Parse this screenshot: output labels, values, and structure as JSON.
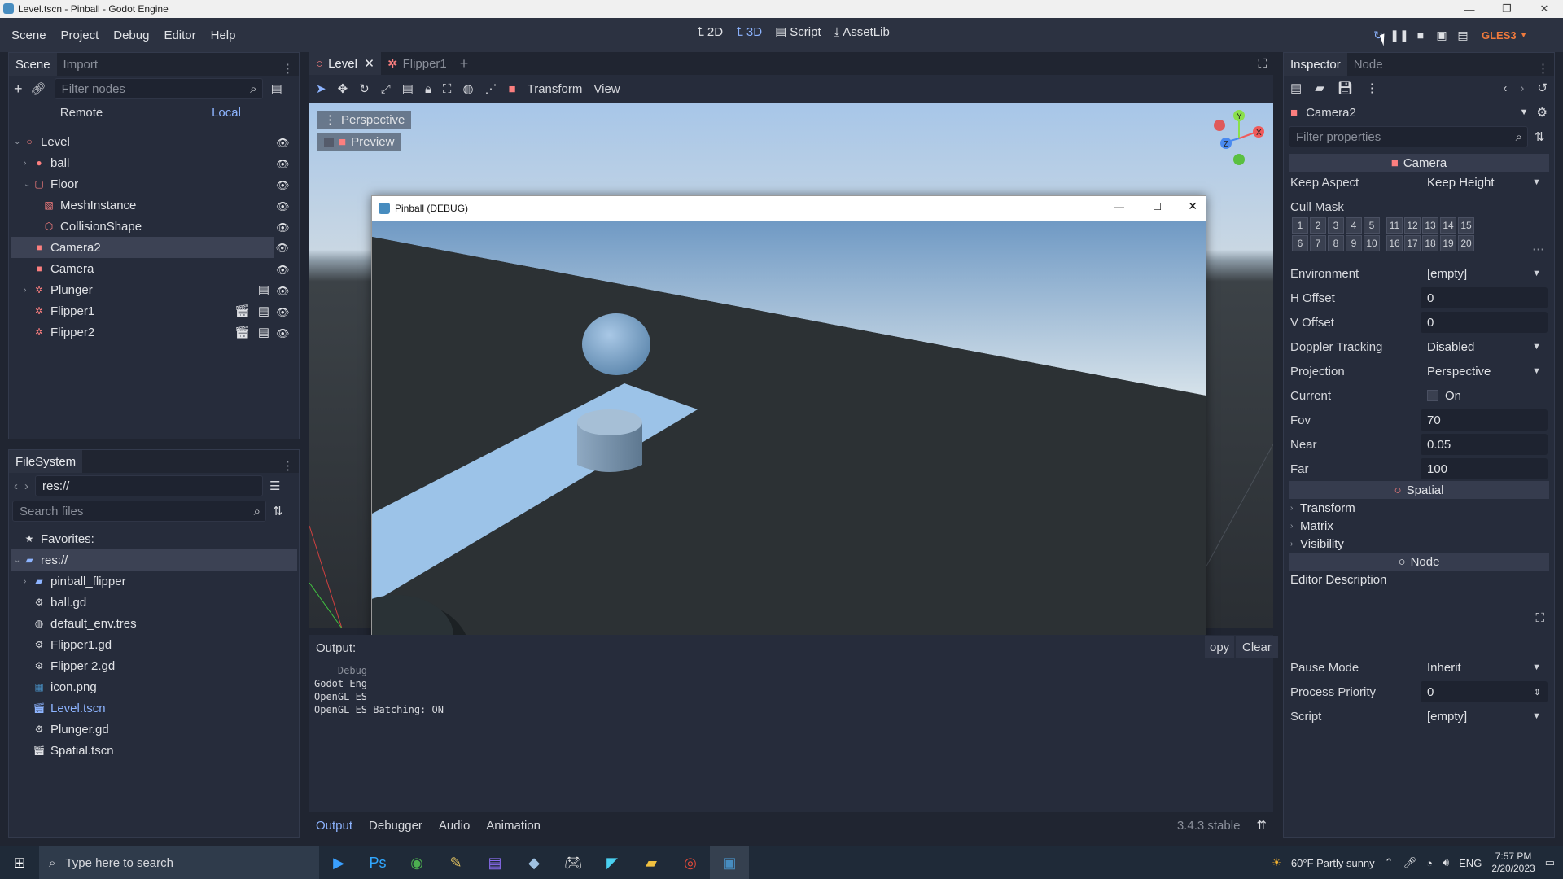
{
  "window": {
    "title": "Level.tscn - Pinball - Godot Engine"
  },
  "menu": [
    "Scene",
    "Project",
    "Debug",
    "Editor",
    "Help"
  ],
  "modes": [
    {
      "label": "2D"
    },
    {
      "label": "3D"
    },
    {
      "label": "Script"
    },
    {
      "label": "AssetLib"
    }
  ],
  "renderer": "GLES3",
  "scene_panel": {
    "tabs": [
      "Scene",
      "Import"
    ],
    "filter_placeholder": "Filter nodes",
    "remote": "Remote",
    "local": "Local",
    "nodes": [
      {
        "name": "Level",
        "depth": 0
      },
      {
        "name": "ball",
        "depth": 1
      },
      {
        "name": "Floor",
        "depth": 1
      },
      {
        "name": "MeshInstance",
        "depth": 2
      },
      {
        "name": "CollisionShape",
        "depth": 2
      },
      {
        "name": "Camera2",
        "depth": 1
      },
      {
        "name": "Camera",
        "depth": 1
      },
      {
        "name": "Plunger",
        "depth": 1
      },
      {
        "name": "Flipper1",
        "depth": 1
      },
      {
        "name": "Flipper2",
        "depth": 1
      }
    ]
  },
  "filesystem": {
    "tab": "FileSystem",
    "path": "res://",
    "search_placeholder": "Search files",
    "favorites": "Favorites:",
    "root": "res://",
    "items": [
      "pinball_flipper",
      "ball.gd",
      "default_env.tres",
      "Flipper1.gd",
      "Flipper 2.gd",
      "icon.png",
      "Level.tscn",
      "Plunger.gd",
      "Spatial.tscn"
    ]
  },
  "editor_tabs": [
    "Level",
    "Flipper1"
  ],
  "viewport_toolbar": {
    "transform": "Transform",
    "view": "View"
  },
  "viewport": {
    "perspective": "Perspective",
    "preview": "Preview"
  },
  "debug_window": {
    "title": "Pinball (DEBUG)"
  },
  "output": {
    "label": "Output:",
    "copy": "opy",
    "clear": "Clear",
    "lines": [
      "--- Debug",
      "Godot Eng",
      "OpenGL ES",
      "OpenGL ES Batching: ON"
    ]
  },
  "bottom_tabs": [
    "Output",
    "Debugger",
    "Audio",
    "Animation"
  ],
  "version": "3.4.3.stable",
  "inspector": {
    "tabs": [
      "Inspector",
      "Node"
    ],
    "object": "Camera2",
    "filter_placeholder": "Filter properties",
    "camera_section": "Camera",
    "props": {
      "keep_aspect": {
        "label": "Keep Aspect",
        "value": "Keep Height"
      },
      "cull_mask": {
        "label": "Cull Mask",
        "row1": [
          "1",
          "2",
          "3",
          "4",
          "5",
          "11",
          "12",
          "13",
          "14",
          "15"
        ],
        "row2": [
          "6",
          "7",
          "8",
          "9",
          "10",
          "16",
          "17",
          "18",
          "19",
          "20"
        ]
      },
      "environment": {
        "label": "Environment",
        "value": "[empty]"
      },
      "h_offset": {
        "label": "H Offset",
        "value": "0"
      },
      "v_offset": {
        "label": "V Offset",
        "value": "0"
      },
      "doppler": {
        "label": "Doppler Tracking",
        "value": "Disabled"
      },
      "projection": {
        "label": "Projection",
        "value": "Perspective"
      },
      "current": {
        "label": "Current",
        "value": "On"
      },
      "fov": {
        "label": "Fov",
        "value": "70"
      },
      "near": {
        "label": "Near",
        "value": "0.05"
      },
      "far": {
        "label": "Far",
        "value": "100"
      }
    },
    "spatial_section": "Spatial",
    "spatial_sub": [
      "Transform",
      "Matrix",
      "Visibility"
    ],
    "node_section": "Node",
    "editor_description": "Editor Description",
    "pause_mode": {
      "label": "Pause Mode",
      "value": "Inherit"
    },
    "process_priority": {
      "label": "Process Priority",
      "value": "0"
    },
    "script": {
      "label": "Script",
      "value": "[empty]"
    }
  },
  "taskbar": {
    "search_placeholder": "Type here to search",
    "weather": "60°F  Partly sunny",
    "lang": "ENG",
    "time": "7:57 PM",
    "date": "2/20/2023"
  }
}
